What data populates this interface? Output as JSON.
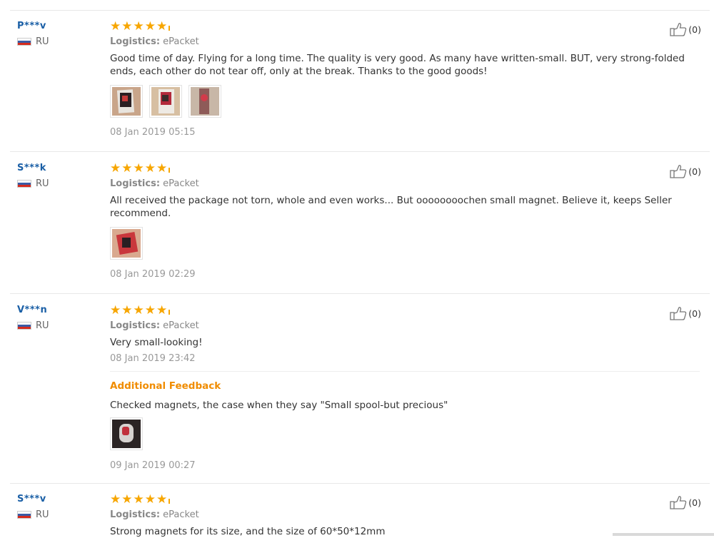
{
  "reviews": [
    {
      "user": "P***v",
      "country": "RU",
      "logistics_label": "Logistics:",
      "logistics_value": "ePacket",
      "text": "Good time of day. Flying for a long time. The quality is very good. As many have written-small. BUT, very strong-folded ends, each other do not tear off, only at the break. Thanks to the good goods!",
      "date": "08 Jan 2019 05:15",
      "likes": "(0)",
      "rating": 5
    },
    {
      "user": "S***k",
      "country": "RU",
      "logistics_label": "Logistics:",
      "logistics_value": "ePacket",
      "text": "All received the package not torn, whole and even works... But oooooooochen small magnet. Believe it, keeps Seller recommend.",
      "date": "08 Jan 2019 02:29",
      "likes": "(0)",
      "rating": 5
    },
    {
      "user": "V***n",
      "country": "RU",
      "logistics_label": "Logistics:",
      "logistics_value": "ePacket",
      "text": "Very small-looking!",
      "date": "08 Jan 2019 23:42",
      "likes": "(0)",
      "rating": 5,
      "additional_title": "Additional Feedback",
      "additional_text": "Checked magnets, the case when they say \"Small spool-but precious\"",
      "additional_date": "09 Jan 2019 00:27"
    },
    {
      "user": "S***v",
      "country": "RU",
      "logistics_label": "Logistics:",
      "logistics_value": "ePacket",
      "text": "Strong magnets for its size, and the size of 60*50*12mm",
      "likes": "(0)",
      "rating": 5
    }
  ],
  "icons": {
    "star": "star-icon",
    "like": "thumbs-up-icon",
    "flag": "russia-flag-icon"
  },
  "colors": {
    "username": "#1a5fa6",
    "star": "#f7a600",
    "additional_feedback": "#f08c00"
  }
}
